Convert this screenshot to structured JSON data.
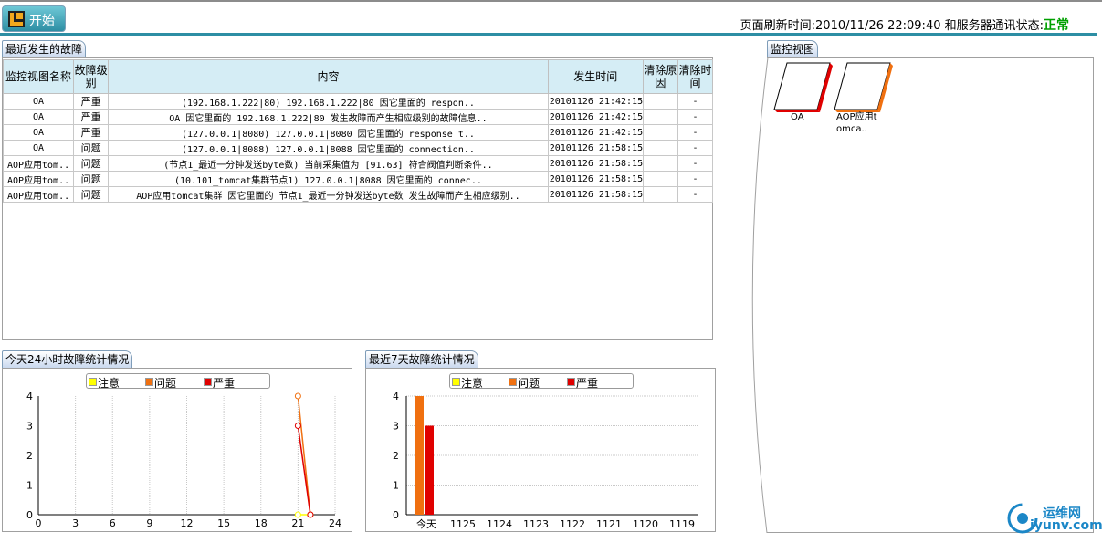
{
  "header": {
    "start_label": "开始",
    "refresh_label": "页面刷新时间:2010/11/26 22:09:40 和服务器通讯状态:",
    "status": "正常",
    "status_color": "#00a000"
  },
  "faults": {
    "tab_title": "最近发生的故障",
    "columns": [
      "监控视图名称",
      "故障级别",
      "内容",
      "发生时间",
      "清除原因",
      "清除时间"
    ],
    "rows": [
      [
        "OA",
        "严重",
        "(192.168.1.222|80) 192.168.1.222|80 因它里面的 respon..",
        "20101126 21:42:15",
        "",
        "-"
      ],
      [
        "OA",
        "严重",
        "OA 因它里面的 192.168.1.222|80 发生故障而产生相应级别的故障信息..",
        "20101126 21:42:15",
        "",
        "-"
      ],
      [
        "OA",
        "严重",
        "(127.0.0.1|8080) 127.0.0.1|8080 因它里面的 response t..",
        "20101126 21:42:15",
        "",
        "-"
      ],
      [
        "OA",
        "问题",
        "(127.0.0.1|8088) 127.0.0.1|8088 因它里面的 connection..",
        "20101126 21:58:15",
        "",
        "-"
      ],
      [
        "AOP应用tom..",
        "问题",
        "(节点1_最近一分钟发送byte数) 当前采集值为 [91.63] 符合阀值判断条件..",
        "20101126 21:58:15",
        "",
        "-"
      ],
      [
        "AOP应用tom..",
        "问题",
        "(10.101_tomcat集群节点1) 127.0.0.1|8088 因它里面的 connec..",
        "20101126 21:58:15",
        "",
        "-"
      ],
      [
        "AOP应用tom..",
        "问题",
        "AOP应用tomcat集群 因它里面的 节点1_最近一分钟发送byte数 发生故障而产生相应级别..",
        "20101126 21:58:15",
        "",
        "-"
      ]
    ]
  },
  "monitor": {
    "tab_title": "监控视图",
    "items": [
      {
        "label": "OA",
        "color": "#e00000"
      },
      {
        "label": "AOP应用tomca..",
        "color": "#f07010"
      }
    ]
  },
  "legend_items": [
    {
      "label": "注意",
      "color": "#ffff00"
    },
    {
      "label": "问题",
      "color": "#f07010"
    },
    {
      "label": "严重",
      "color": "#e00000"
    }
  ],
  "chart_data": [
    {
      "title": "今天24小时故障统计情况",
      "type": "line",
      "x_ticks": [
        0,
        3,
        6,
        9,
        12,
        15,
        18,
        21,
        24
      ],
      "y_ticks": [
        0,
        1,
        2,
        3,
        4
      ],
      "xlim": [
        0,
        24
      ],
      "ylim": [
        0,
        4
      ],
      "grid": "vertical",
      "legend_position": "top",
      "series": [
        {
          "name": "注意",
          "color": "#ffff00",
          "points": [
            [
              21,
              0
            ],
            [
              22,
              0
            ]
          ]
        },
        {
          "name": "问题",
          "color": "#f07010",
          "points": [
            [
              21,
              4
            ],
            [
              22,
              0
            ]
          ]
        },
        {
          "name": "严重",
          "color": "#e00000",
          "points": [
            [
              21,
              3
            ],
            [
              22,
              0
            ]
          ]
        }
      ]
    },
    {
      "title": "最近7天故障统计情况",
      "type": "bar",
      "categories": [
        "今天",
        "1125",
        "1124",
        "1123",
        "1122",
        "1121",
        "1120",
        "1119"
      ],
      "y_ticks": [
        0,
        1,
        2,
        3,
        4
      ],
      "ylim": [
        0,
        4
      ],
      "grid": "horizontal",
      "legend_position": "top",
      "series": [
        {
          "name": "注意",
          "color": "#ffff00",
          "values": [
            0,
            0,
            0,
            0,
            0,
            0,
            0,
            0
          ]
        },
        {
          "name": "问题",
          "color": "#f07010",
          "values": [
            4,
            0,
            0,
            0,
            0,
            0,
            0,
            0
          ]
        },
        {
          "name": "严重",
          "color": "#e00000",
          "values": [
            3,
            0,
            0,
            0,
            0,
            0,
            0,
            0
          ]
        }
      ]
    }
  ],
  "watermark": {
    "line1": "运维网",
    "line2": "iyunv.com"
  }
}
